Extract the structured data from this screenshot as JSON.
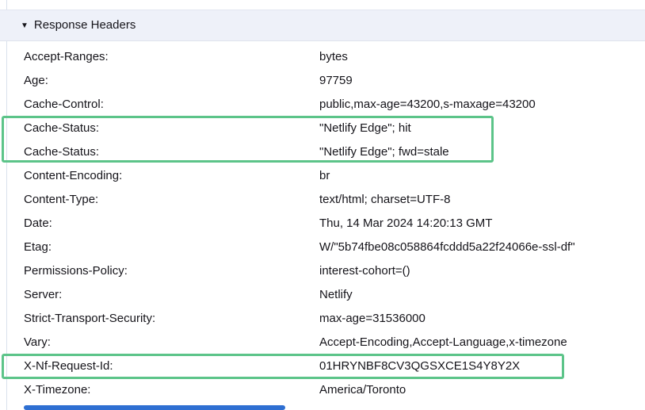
{
  "section": {
    "title": "Response Headers",
    "collapse_icon": "▼"
  },
  "headers": [
    {
      "name": "Accept-Ranges:",
      "value": "bytes"
    },
    {
      "name": "Age:",
      "value": "97759"
    },
    {
      "name": "Cache-Control:",
      "value": "public,max-age=43200,s-maxage=43200"
    },
    {
      "name": "Cache-Status:",
      "value": "\"Netlify Edge\"; hit",
      "highlighted": true
    },
    {
      "name": "Cache-Status:",
      "value": "\"Netlify Edge\"; fwd=stale",
      "highlighted": true
    },
    {
      "name": "Content-Encoding:",
      "value": "br"
    },
    {
      "name": "Content-Type:",
      "value": "text/html; charset=UTF-8"
    },
    {
      "name": "Date:",
      "value": "Thu, 14 Mar 2024 14:20:13 GMT"
    },
    {
      "name": "Etag:",
      "value": "W/\"5b74fbe08c058864fcddd5a22f24066e-ssl-df\""
    },
    {
      "name": "Permissions-Policy:",
      "value": "interest-cohort=()"
    },
    {
      "name": "Server:",
      "value": "Netlify"
    },
    {
      "name": "Strict-Transport-Security:",
      "value": "max-age=31536000"
    },
    {
      "name": "Vary:",
      "value": "Accept-Encoding,Accept-Language,x-timezone"
    },
    {
      "name": "X-Nf-Request-Id:",
      "value": "01HRYNBF8CV3QGSXCE1S4Y8Y2X",
      "highlighted": true
    },
    {
      "name": "X-Timezone:",
      "value": "America/Toronto"
    }
  ],
  "colors": {
    "highlight-border": "#5cc489",
    "section-bg": "#eef1f9",
    "scrollbar-blue": "#2e6fd2",
    "text": "#15141a"
  }
}
